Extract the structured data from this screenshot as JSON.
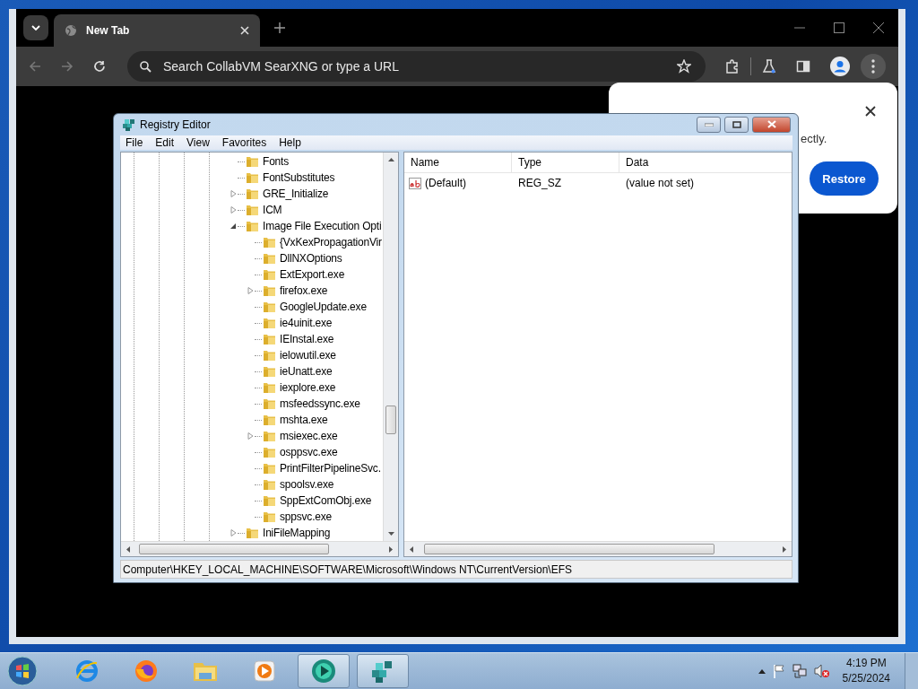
{
  "browser": {
    "tab": {
      "title": "New Tab",
      "selected": true
    },
    "address_bar": {
      "placeholder": "Search CollabVM SearXNG or type a URL"
    }
  },
  "restore_popup": {
    "message": "ectly.",
    "button": "Restore"
  },
  "registry_editor": {
    "title": "Registry Editor",
    "menu": [
      "File",
      "Edit",
      "View",
      "Favorites",
      "Help"
    ],
    "tree": [
      {
        "label": "Fonts"
      },
      {
        "label": "FontSubstitutes"
      },
      {
        "label": "GRE_Initialize",
        "expanded": false
      },
      {
        "label": "ICM",
        "expanded": false
      },
      {
        "label": "Image File Execution Opti",
        "expanded": true,
        "children": [
          {
            "label": "{VxKexPropagationVir"
          },
          {
            "label": "DllNXOptions"
          },
          {
            "label": "ExtExport.exe"
          },
          {
            "label": "firefox.exe",
            "expanded": false
          },
          {
            "label": "GoogleUpdate.exe"
          },
          {
            "label": "ie4uinit.exe"
          },
          {
            "label": "IEInstal.exe"
          },
          {
            "label": "ielowutil.exe"
          },
          {
            "label": "ieUnatt.exe"
          },
          {
            "label": "iexplore.exe"
          },
          {
            "label": "msfeedssync.exe"
          },
          {
            "label": "mshta.exe"
          },
          {
            "label": "msiexec.exe",
            "expanded": false
          },
          {
            "label": "osppsvc.exe"
          },
          {
            "label": "PrintFilterPipelineSvc."
          },
          {
            "label": "spoolsv.exe"
          },
          {
            "label": "SppExtComObj.exe"
          },
          {
            "label": "sppsvc.exe"
          }
        ]
      },
      {
        "label": "IniFileMapping",
        "expanded": false
      }
    ],
    "values": {
      "columns": [
        "Name",
        "Type",
        "Data"
      ],
      "rows": [
        {
          "name": "(Default)",
          "type": "REG_SZ",
          "data": "(value not set)"
        }
      ]
    },
    "status_bar": "Computer\\HKEY_LOCAL_MACHINE\\SOFTWARE\\Microsoft\\Windows NT\\CurrentVersion\\EFS"
  },
  "taskbar": {
    "apps": [
      {
        "kind": "ie",
        "active": false
      },
      {
        "kind": "firefox",
        "active": false
      },
      {
        "kind": "explorer",
        "active": false
      },
      {
        "kind": "media",
        "active": false
      },
      {
        "kind": "vm",
        "active": true
      },
      {
        "kind": "regedit",
        "active": true
      }
    ],
    "clock": {
      "time": "4:19 PM",
      "date": "5/25/2024"
    }
  }
}
